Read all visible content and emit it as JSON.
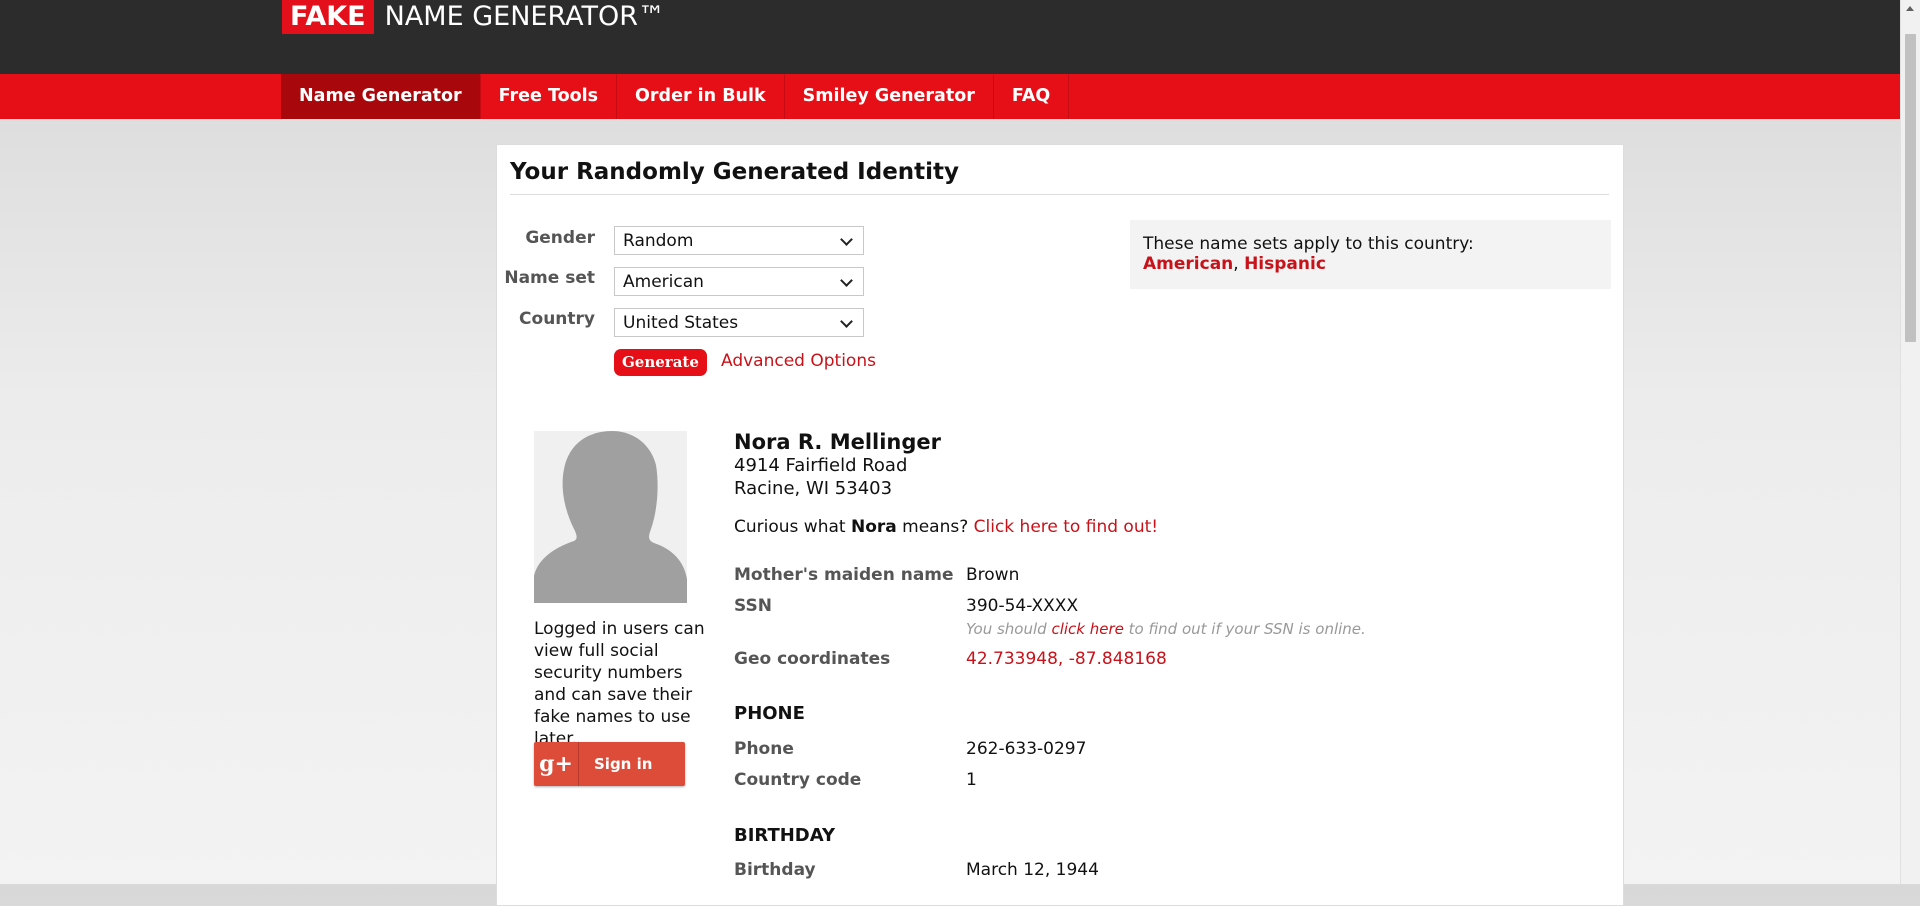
{
  "header": {
    "logo_fake": "FAKE",
    "logo_name": "NAME GENERATOR™"
  },
  "nav": [
    "Name Generator",
    "Free Tools",
    "Order in Bulk",
    "Smiley Generator",
    "FAQ"
  ],
  "page_title": "Your Randomly Generated Identity",
  "form": {
    "gender_label": "Gender",
    "gender_value": "Random",
    "nameset_label": "Name set",
    "nameset_value": "American",
    "country_label": "Country",
    "country_value": "United States",
    "generate_label": "Generate",
    "advanced_label": "Advanced Options"
  },
  "nameset_info": {
    "text": "These name sets apply to this country:",
    "link1": "American",
    "sep": ",",
    "link2": "Hispanic"
  },
  "login": {
    "text": "Logged in users can view full social security numbers and can save their fake names to use later.",
    "gplus": "g+",
    "signin": "Sign in"
  },
  "identity": {
    "name": "Nora R. Mellinger",
    "address_line1": "4914 Fairfield Road",
    "address_line2": "Racine, WI 53403",
    "curious_prefix": "Curious what",
    "first_name": "Nora",
    "curious_mid": "means?",
    "curious_link": "Click here to find out!"
  },
  "details": {
    "maiden_label": "Mother's maiden name",
    "maiden_value": "Brown",
    "ssn_label": "SSN",
    "ssn_value": "390-54-XXXX",
    "ssn_note_prefix": "You should",
    "ssn_note_link": "click here",
    "ssn_note_suffix": "to find out if your SSN is online.",
    "geo_label": "Geo coordinates",
    "geo_value": "42.733948, -87.848168"
  },
  "phone_section": {
    "title": "PHONE",
    "phone_label": "Phone",
    "phone_value": "262-633-0297",
    "cc_label": "Country code",
    "cc_value": "1"
  },
  "birthday_section": {
    "title": "BIRTHDAY",
    "birthday_label": "Birthday",
    "birthday_value": "March 12, 1944"
  },
  "colors": {
    "brand_red": "#e60f17",
    "dark_bar": "#2c2c2c",
    "link_red": "#c81219"
  }
}
